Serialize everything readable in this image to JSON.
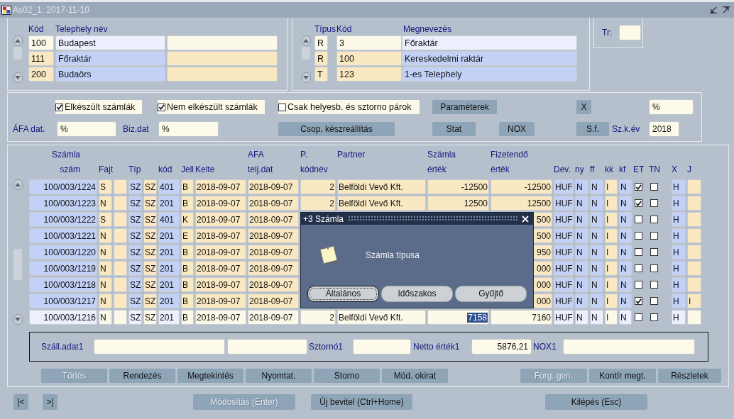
{
  "window": {
    "title": "As02_1: 2017-11-10"
  },
  "sites": {
    "headers": {
      "kod": "Kód",
      "nev": "Telephely név"
    },
    "rows": [
      {
        "kod": "100",
        "nev": "Budapest",
        "selected": true
      },
      {
        "kod": "111",
        "nev": "Főraktár",
        "selected": false
      },
      {
        "kod": "200",
        "nev": "Budaörs",
        "selected": false
      }
    ]
  },
  "types": {
    "headers": {
      "tipus": "Típus",
      "kod": "Kód",
      "megnevezes": "Megnevezés"
    },
    "rows": [
      {
        "tipus": "R",
        "kod": "3",
        "megnevezes": "Főraktár",
        "selected": true
      },
      {
        "tipus": "R",
        "kod": "100",
        "megnevezes": "Kereskedelmi raktár",
        "selected": false
      },
      {
        "tipus": "T",
        "kod": "123",
        "megnevezes": "1-es Telephely",
        "selected": false
      }
    ]
  },
  "tr": {
    "label": "Tr:"
  },
  "filters": {
    "checkboxes": [
      {
        "label": "Elkészült számlák",
        "checked": true
      },
      {
        "label": "Nem elkészült számlák",
        "checked": true
      },
      {
        "label": "Csak helyesb. és sztorno párok",
        "checked": false
      }
    ],
    "parameters_button": {
      "label": "Paraméterek"
    },
    "x_button": {
      "label": "X"
    },
    "x_field": {
      "value": "%"
    },
    "afa_dat": {
      "label": "ÁFA dat.",
      "value": "%"
    },
    "biz_dat": {
      "label": "Biz.dat",
      "value": "%"
    },
    "csop_button": {
      "label": "Csop. készreállítás"
    },
    "stat_button": {
      "label": "Stat"
    },
    "nox_button": {
      "label": "NOX"
    },
    "sf_button": {
      "label": "S.f."
    },
    "szk_ev": {
      "label": "Sz.k.év",
      "value": "2018"
    }
  },
  "table": {
    "headers": {
      "szam": {
        "top": "Számla",
        "bottom": "szám"
      },
      "fajt": {
        "bottom": "Fajt"
      },
      "tip": {
        "bottom": "Típ"
      },
      "kod": {
        "bottom": "kód"
      },
      "jell": {
        "bottom": "Jell"
      },
      "kelte": {
        "bottom": "Kelte"
      },
      "afa": {
        "top": "AFA",
        "bottom": "telj.dat"
      },
      "p": {
        "top": "P.",
        "bottom": "kódnév"
      },
      "partner": {
        "top": "Partner"
      },
      "szamla": {
        "top": "Számla",
        "bottom": "érték"
      },
      "fiz": {
        "top": "Fizetendő",
        "bottom": "érték"
      },
      "dev": {
        "bottom": "Dev."
      },
      "ny": {
        "bottom": "ny"
      },
      "ff": {
        "bottom": "ff"
      },
      "kk": {
        "bottom": "kk"
      },
      "kf": {
        "bottom": "kf"
      },
      "et": {
        "bottom": "ET"
      },
      "tn": {
        "bottom": "TN"
      },
      "x": {
        "bottom": "X"
      },
      "j": {
        "bottom": "J"
      }
    },
    "rows": [
      {
        "szam": "100/003/1224",
        "fajt": "S",
        "tip": "SZ",
        "col5": "SZ",
        "kod": "401",
        "jell": "B",
        "kelte": "2018-09-07",
        "afa": "2018-09-07",
        "p": "2",
        "partner": "Belföldi Vevő Kft.",
        "szamla": "-12500",
        "fiz": "-12500",
        "dev": "HUF",
        "ny": "N",
        "ff": "N",
        "kk": "I",
        "kf": "N",
        "et": true,
        "tn": false,
        "x": "H",
        "selected": false,
        "value_highlighted": false
      },
      {
        "szam": "100/003/1223",
        "fajt": "N",
        "tip": "SZ",
        "col5": "SZ",
        "kod": "201",
        "jell": "B",
        "kelte": "2018-09-07",
        "afa": "2018-09-07",
        "p": "2",
        "partner": "Belföldi Vevő Kft.",
        "szamla": "12500",
        "fiz": "12500",
        "dev": "HUF",
        "ny": "N",
        "ff": "N",
        "kk": "I",
        "kf": "N",
        "et": true,
        "tn": false,
        "x": "H",
        "selected": false,
        "value_highlighted": false
      },
      {
        "szam": "100/003/1222",
        "fajt": "S",
        "tip": "SZ",
        "col5": "SZ",
        "kod": "401",
        "jell": "K",
        "kelte": "2018-09-07",
        "afa": "2018-09-07",
        "fiz": "500",
        "dev": "HUF",
        "ny": "N",
        "ff": "N",
        "kk": "I",
        "kf": "N",
        "et": false,
        "tn": false,
        "x": "H",
        "selected": false,
        "value_highlighted": false
      },
      {
        "szam": "100/003/1221",
        "fajt": "N",
        "tip": "SZ",
        "col5": "SZ",
        "kod": "201",
        "jell": "E",
        "kelte": "2018-09-07",
        "afa": "2018-09-07",
        "fiz": "500",
        "dev": "HUF",
        "ny": "N",
        "ff": "N",
        "kk": "I",
        "kf": "N",
        "et": false,
        "tn": false,
        "x": "H",
        "selected": false,
        "value_highlighted": false
      },
      {
        "szam": "100/003/1220",
        "fajt": "N",
        "tip": "SZ",
        "col5": "SZ",
        "kod": "201",
        "jell": "B",
        "kelte": "2018-09-07",
        "afa": "2018-09-07",
        "fiz": "950",
        "dev": "HUF",
        "ny": "N",
        "ff": "N",
        "kk": "I",
        "kf": "N",
        "et": false,
        "tn": false,
        "x": "H",
        "selected": false,
        "value_highlighted": false
      },
      {
        "szam": "100/003/1219",
        "fajt": "N",
        "tip": "SZ",
        "col5": "SZ",
        "kod": "201",
        "jell": "B",
        "kelte": "2018-09-07",
        "afa": "2018-09-07",
        "fiz": "000",
        "dev": "HUF",
        "ny": "N",
        "ff": "N",
        "kk": "I",
        "kf": "N",
        "et": false,
        "tn": false,
        "x": "H",
        "selected": false,
        "value_highlighted": false
      },
      {
        "szam": "100/003/1218",
        "fajt": "N",
        "tip": "SZ",
        "col5": "SZ",
        "kod": "201",
        "jell": "B",
        "kelte": "2018-09-07",
        "afa": "2018-09-07",
        "fiz": "000",
        "dev": "HUF",
        "ny": "N",
        "ff": "N",
        "kk": "I",
        "kf": "N",
        "et": false,
        "tn": false,
        "x": "H",
        "selected": false,
        "value_highlighted": false
      },
      {
        "szam": "100/003/1217",
        "fajt": "N",
        "tip": "SZ",
        "col5": "SZ",
        "kod": "201",
        "jell": "B",
        "kelte": "2018-09-07",
        "afa": "2018-09-07",
        "fiz": "000",
        "dev": "HUF",
        "ny": "N",
        "ff": "N",
        "kk": "I",
        "kf": "N",
        "et": true,
        "tn": false,
        "x": "H",
        "j": "I",
        "selected": false,
        "value_highlighted": false
      },
      {
        "szam": "100/003/1216",
        "fajt": "N",
        "tip": "SZ",
        "col5": "SZ",
        "kod": "201",
        "jell": "B",
        "kelte": "2018-09-07",
        "afa": "2018-09-07",
        "p": "2",
        "partner": "Belföldi Vevő Kft.",
        "szamla": "7158",
        "fiz": "7160",
        "dev": "HUF",
        "ny": "N",
        "ff": "N",
        "kk": "I",
        "kf": "N",
        "et": false,
        "tn": false,
        "x": "H",
        "selected": true,
        "value_highlighted": true
      }
    ]
  },
  "details": {
    "szall_adat": {
      "label": "Száll.adat1"
    },
    "sztorno": {
      "label": "Sztornó1"
    },
    "netto": {
      "label": "Netto érték1",
      "value": "5876,21"
    },
    "nox1": {
      "label": "NOX1"
    }
  },
  "actions": [
    {
      "label": "Törlés",
      "disabled": true
    },
    {
      "label": "Rendezés",
      "disabled": false
    },
    {
      "label": "Megtekintés",
      "disabled": false
    },
    {
      "label": "Nyomtat.",
      "disabled": false
    },
    {
      "label": "Storno",
      "disabled": false
    },
    {
      "label": "Mód. okirat",
      "disabled": false
    }
  ],
  "actions_right": [
    {
      "label": "Forg. gen.",
      "disabled": true
    },
    {
      "label": "Kontír megt.",
      "disabled": false
    },
    {
      "label": "Részletek",
      "disabled": false
    }
  ],
  "footer": {
    "first": "|<",
    "last": ">|",
    "buttons": [
      {
        "label": "Módosítás (Enter)",
        "disabled": true
      },
      {
        "label": "Új bevitel (Ctrl+Home)",
        "disabled": false
      },
      {
        "label": "Kilépés (Esc)",
        "disabled": false
      }
    ]
  },
  "dialog": {
    "title": "+3 Számla",
    "message": "Számla típusa",
    "buttons": [
      {
        "label": "Általános",
        "selected": true
      },
      {
        "label": "Időszakos",
        "selected": false
      },
      {
        "label": "Gyűjtő",
        "selected": false
      }
    ]
  }
}
